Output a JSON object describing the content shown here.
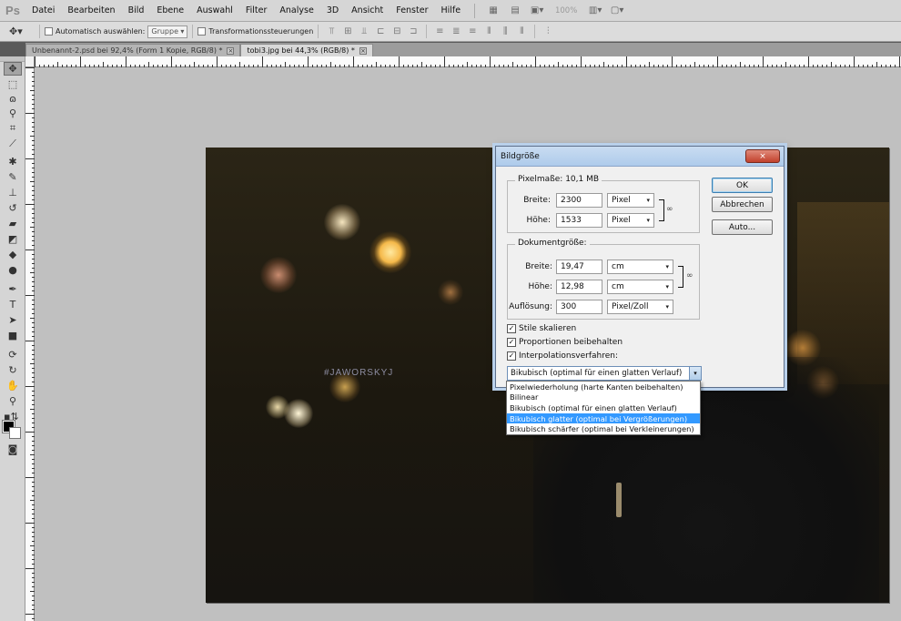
{
  "menubar": {
    "logo": "Ps",
    "items": [
      "Datei",
      "Bearbeiten",
      "Bild",
      "Ebene",
      "Auswahl",
      "Filter",
      "Analyse",
      "3D",
      "Ansicht",
      "Fenster",
      "Hilfe"
    ],
    "zoom": "100%"
  },
  "options": {
    "auto_select_label": "Automatisch auswählen:",
    "auto_select_value": "Gruppe",
    "transform_label": "Transformationssteuerungen"
  },
  "tabs": [
    {
      "label": "Unbenannt-2.psd bei 92,4% (Form 1 Kopie, RGB/8) *",
      "active": false
    },
    {
      "label": "tobi3.jpg bei 44,3% (RGB/8) *",
      "active": true
    }
  ],
  "icons": {
    "close": "×",
    "dropdown": "▾",
    "checkmark": "✓",
    "chain": "link-icon"
  },
  "canvas": {
    "watermark": "#JAWORSKYJ"
  },
  "dialog": {
    "title": "Bildgröße",
    "pixel_section": "Pixelmaße: 10,1 MB",
    "pixel_width_label": "Breite:",
    "pixel_width_value": "2300",
    "pixel_width_unit": "Pixel",
    "pixel_height_label": "Höhe:",
    "pixel_height_value": "1533",
    "pixel_height_unit": "Pixel",
    "doc_section": "Dokumentgröße:",
    "doc_width_label": "Breite:",
    "doc_width_value": "19,47",
    "doc_width_unit": "cm",
    "doc_height_label": "Höhe:",
    "doc_height_value": "12,98",
    "doc_height_unit": "cm",
    "resolution_label": "Auflösung:",
    "resolution_value": "300",
    "resolution_unit": "Pixel/Zoll",
    "ok_label": "OK",
    "cancel_label": "Abbrechen",
    "auto_label": "Auto...",
    "scale_styles_label": "Stile skalieren",
    "constrain_label": "Proportionen beibehalten",
    "resample_label": "Interpolationsverfahren:",
    "resample_value": "Bikubisch (optimal für einen glatten Verlauf)",
    "resample_options": [
      "Pixelwiederholung (harte Kanten beibehalten)",
      "Bilinear",
      "Bikubisch (optimal für einen glatten Verlauf)",
      "Bikubisch glatter (optimal bei Vergrößerungen)",
      "Bikubisch schärfer (optimal bei Verkleinerungen)"
    ],
    "highlighted_option": 3
  }
}
